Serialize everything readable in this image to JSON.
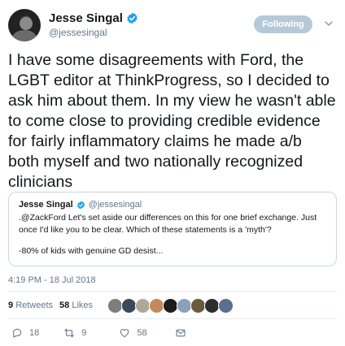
{
  "author": {
    "display_name": "Jesse Singal",
    "handle": "@jessesingal",
    "avatar_icon": "profile-photo",
    "verified_icon": "verified-badge-icon"
  },
  "follow_button": {
    "label": "Following"
  },
  "tweet": {
    "text": "I have some disagreements with Ford, the LGBT editor at ThinkProgress, so I decided to ask him about them. In my view he wasn't able to come close to providing credible evidence for fairly inflammatory claims he made a/b both myself and two nationally recognized clinicians",
    "timestamp": "4:19 PM - 18 Jul 2018"
  },
  "quoted_tweet": {
    "display_name": "Jesse Singal",
    "handle": "@jessesingal",
    "line1": ".@ZackFord Let's set aside our differences on this for one brief exchange. Just once I'd like you to be clear. Which of these statements is a 'myth'?",
    "line2": "-80% of kids with genuine GD desist..."
  },
  "stats": {
    "retweets_count": "9",
    "retweets_label": "Retweets",
    "likes_count": "58",
    "likes_label": "Likes",
    "liker_avatar_colors": [
      "#7d7d7d",
      "#3a4a5c",
      "#b0a79a",
      "#c28a5a",
      "#1d1d1d",
      "#8aa2b8",
      "#6a5a3e",
      "#2e2e2e",
      "#5b6f8e"
    ]
  },
  "actions": {
    "reply_count": "18",
    "retweet_count": "9",
    "like_count": "58"
  },
  "colors": {
    "accent": "#1da1f2",
    "secondary_text": "#657786",
    "follow_button_bg": "#b6c9d8"
  }
}
